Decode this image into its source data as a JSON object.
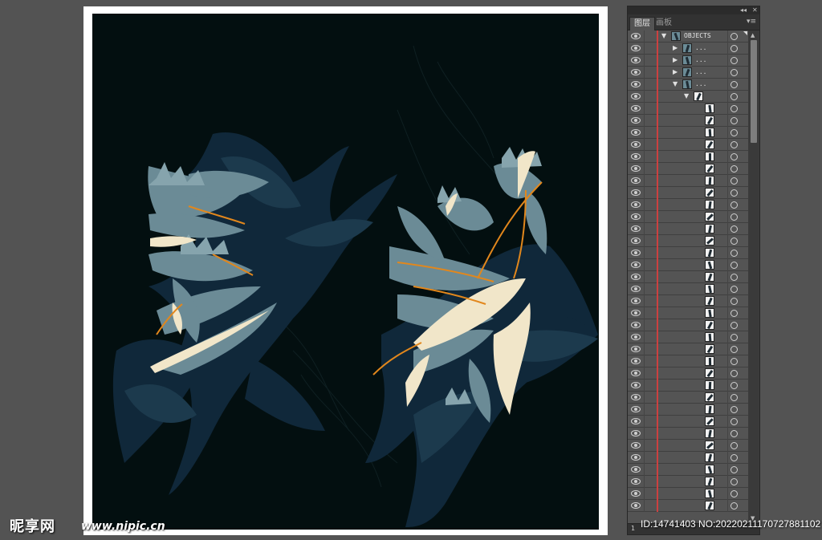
{
  "panel": {
    "tabs": [
      {
        "label": "图层",
        "active": true
      },
      {
        "label": "画板",
        "active": false
      }
    ],
    "collapse_glyph": "◂◂",
    "close_glyph": "✕",
    "menu_glyph": "▾≡",
    "top_layer_name": "OBJECTS",
    "sublayer_name": "...",
    "footer_count": "1",
    "icons": {
      "visibility": "eye-icon",
      "expand": "triangle-down-icon",
      "collapse": "triangle-right-icon",
      "target": "target-circle-icon"
    }
  },
  "watermark": {
    "logo": "昵享网",
    "url": "www.nipic.cn",
    "id_text": "ID:14741403 NO:20220211170727881102"
  },
  "colors": {
    "canvas_bg": "#030f10",
    "leaf_teal": "#6b8b96",
    "leaf_navy": "#10283a",
    "leaf_cream": "#f1e6c9",
    "leaf_orange": "#e2871c",
    "layer_red": "#cc4040"
  }
}
